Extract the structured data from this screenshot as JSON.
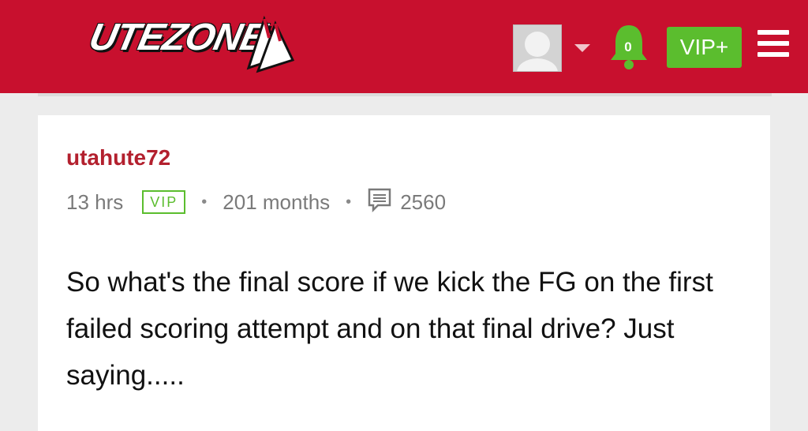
{
  "header": {
    "logo_text": "UTEZONE",
    "notification_count": "0",
    "vip_button_label": "VIP+",
    "colors": {
      "brand": "#c8102e",
      "vip": "#5bbd2e"
    },
    "icons": [
      "avatar",
      "chevron-down-icon",
      "bell-icon",
      "menu-icon"
    ]
  },
  "post": {
    "author": "utahute72",
    "time_ago": "13 hrs",
    "badge": "VIP",
    "member_duration": "201 months",
    "post_count": "2560",
    "text": "So what's the final score if we kick the FG on the first failed scoring attempt and on that final drive? Just saying....."
  }
}
